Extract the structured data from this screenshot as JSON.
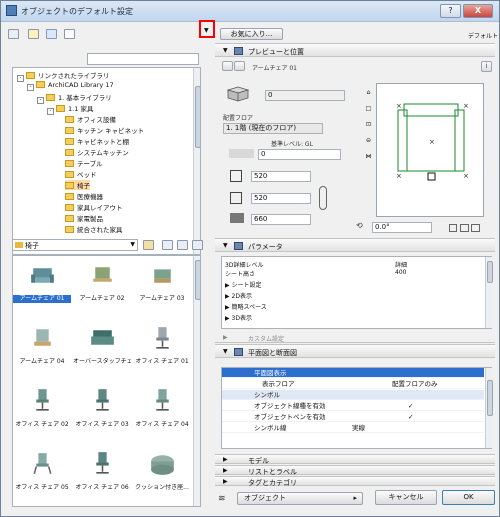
{
  "window": {
    "title": "オブジェクトのデフォルト設定",
    "help_label": "?",
    "close_label": "X"
  },
  "toolbar": {
    "favorites_label": "お気に入り...",
    "default_label": "デフォルト",
    "search_placeholder": ""
  },
  "tree": {
    "items": [
      {
        "label": "リンクされたライブラリ",
        "level": 0
      },
      {
        "label": "ArchiCAD Library 17",
        "level": 1
      },
      {
        "label": "1. 基本ライブラリ",
        "level": 2
      },
      {
        "label": "1.1 家具",
        "level": 3
      },
      {
        "label": "オフィス設備",
        "level": 4
      },
      {
        "label": "キッチン キャビネット",
        "level": 4
      },
      {
        "label": "キャビネットと棚",
        "level": 4
      },
      {
        "label": "システムキッチン",
        "level": 4
      },
      {
        "label": "テーブル",
        "level": 4
      },
      {
        "label": "ベッド",
        "level": 4
      },
      {
        "label": "椅子",
        "level": 4
      },
      {
        "label": "医療機器",
        "level": 4
      },
      {
        "label": "家具レイアウト",
        "level": 4
      },
      {
        "label": "家電製品",
        "level": 4
      },
      {
        "label": "統合された家具",
        "level": 4
      }
    ],
    "selected_index": 10
  },
  "folder_combo": {
    "value": "椅子"
  },
  "gallery": {
    "items": [
      {
        "label": "アームチェア 01"
      },
      {
        "label": "アームチェア 02"
      },
      {
        "label": "アームチェア 03"
      },
      {
        "label": "アームチェア 04"
      },
      {
        "label": "オーバースタッフチェア"
      },
      {
        "label": "オフィス チェア 01"
      },
      {
        "label": "オフィス チェア 02"
      },
      {
        "label": "オフィス チェア 03"
      },
      {
        "label": "オフィス チェア 04"
      },
      {
        "label": "オフィス チェア 05"
      },
      {
        "label": "オフィス チェア 06"
      },
      {
        "label": "クッション付き座..."
      }
    ],
    "selected_index": 0
  },
  "preview_section": {
    "title": "プレビューと位置",
    "object_name": "アームチェア 01",
    "field_zero": "0",
    "placement_floor_label": "配置フロア",
    "placement_floor_value": "1. 1階 (現在のフロア)",
    "elevation_label": "基準レベル: GL",
    "elevation_value": "0",
    "width_value": "520",
    "depth_value": "520",
    "height_value": "660",
    "angle_value": "0.0°"
  },
  "params_section": {
    "title": "パラメータ",
    "rows": [
      {
        "name": "3D詳細レベル",
        "value": "詳細"
      },
      {
        "name": "シート高さ",
        "value": "400"
      },
      {
        "name": "シート設定",
        "value": ""
      },
      {
        "name": "2D表示",
        "value": ""
      },
      {
        "name": "簡略スペース",
        "value": ""
      },
      {
        "name": "3D表示",
        "value": ""
      }
    ]
  },
  "custom_settings_label": "カスタム設定",
  "plan_section": {
    "title": "平面図と断面図",
    "rows": [
      {
        "label": "平面図表示",
        "value": ""
      },
      {
        "label": "表示フロア",
        "value": "配置フロアのみ"
      },
      {
        "label": "シンボル",
        "value": ""
      },
      {
        "label": "オブジェクト線種を有効",
        "value": ""
      },
      {
        "label": "オブジェクトペンを有効",
        "value": ""
      },
      {
        "label": "シンボル線",
        "value": "実線"
      }
    ]
  },
  "collapsed_sections": [
    {
      "label": "モデル"
    },
    {
      "label": "リストとラベル"
    },
    {
      "label": "タグとカテゴリ"
    }
  ],
  "footer": {
    "layer_value": "オブジェクト",
    "cancel_label": "キャンセル",
    "ok_label": "OK"
  },
  "colors": {
    "accent": "#2d6fcf",
    "highlight": "#ff0000"
  }
}
